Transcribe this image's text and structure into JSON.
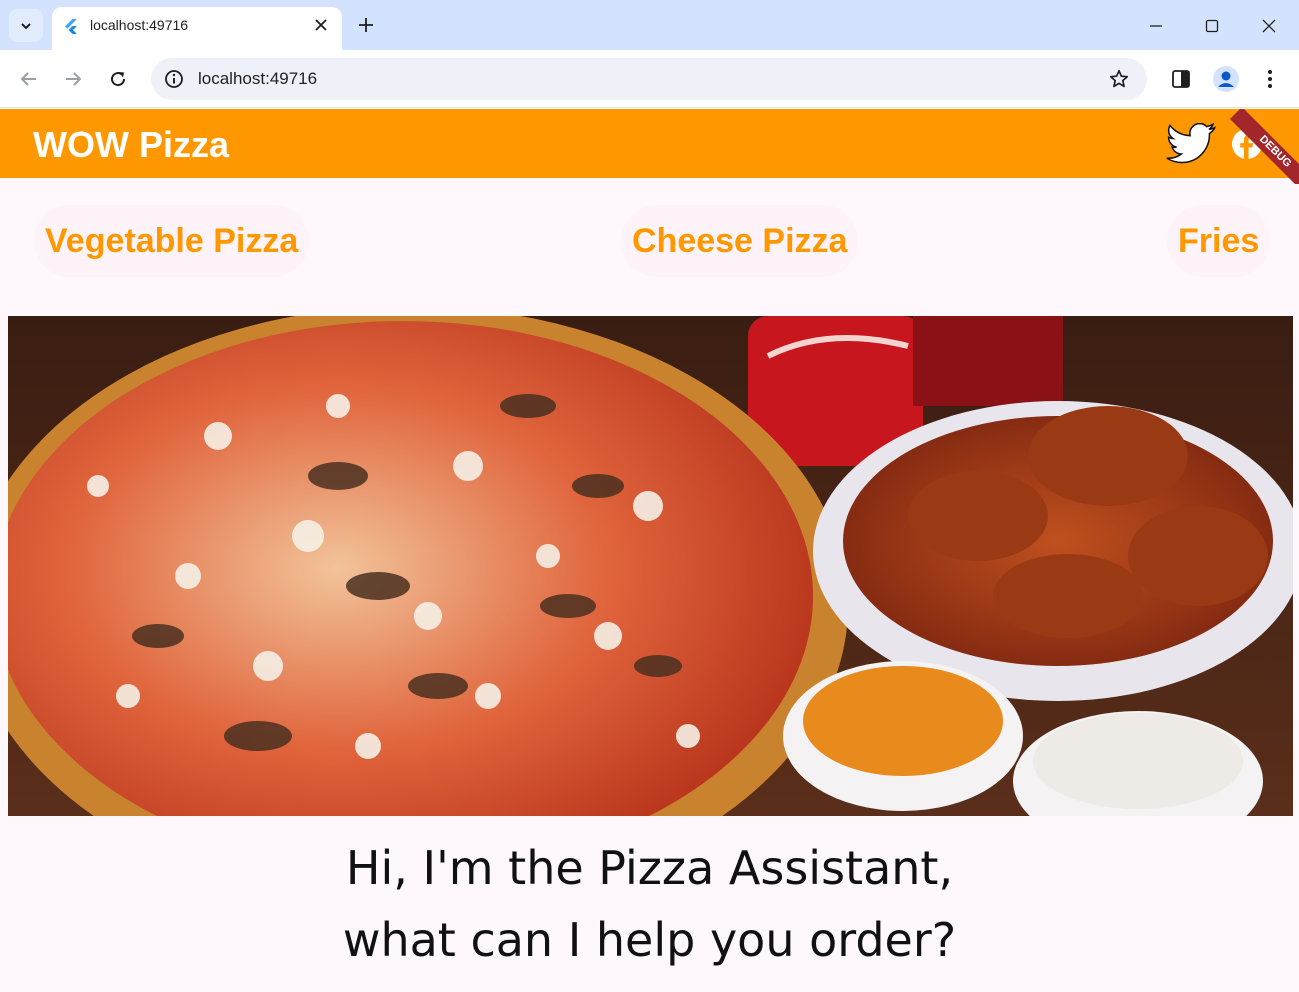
{
  "browser": {
    "tab_title": "localhost:49716",
    "url": "localhost:49716"
  },
  "app": {
    "title": "WOW Pizza",
    "debug_label": "DEBUG",
    "colors": {
      "appbar": "#ff9800",
      "accent": "#ff9800",
      "background": "#fef7fb",
      "debug": "#a2262a"
    },
    "social_icons": [
      "twitter-icon",
      "facebook-icon"
    ],
    "menu": [
      "Vegetable Pizza",
      "Cheese Pizza",
      "Fries"
    ],
    "greeting": {
      "line1": "Hi, I'm the Pizza Assistant,",
      "line2": "what can I help you order?"
    }
  }
}
